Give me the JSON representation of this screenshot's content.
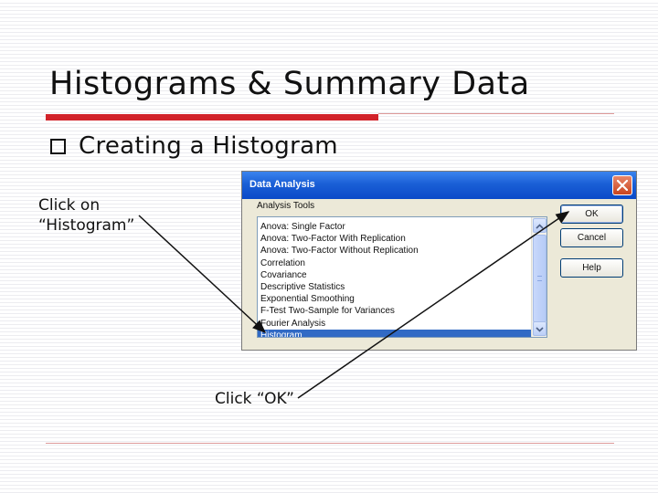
{
  "slide": {
    "title": "Histograms & Summary Data",
    "bullet": "Creating a Histogram",
    "callout_histogram_1": "Click on",
    "callout_histogram_2": "“Histogram”",
    "callout_ok": "Click “OK”"
  },
  "dialog": {
    "title": "Data Analysis",
    "tools_label": "Analysis Tools",
    "items": [
      "Anova: Single Factor",
      "Anova: Two-Factor With Replication",
      "Anova: Two-Factor Without Replication",
      "Correlation",
      "Covariance",
      "Descriptive Statistics",
      "Exponential Smoothing",
      "F-Test Two-Sample for Variances",
      "Fourier Analysis",
      "Histogram"
    ],
    "selected_index": 9,
    "ok_label": "OK",
    "cancel_label": "Cancel",
    "help_label": "Help",
    "close_icon": "close-icon"
  },
  "colors": {
    "accent_red": "#d2232a",
    "titlebar_blue": "#0b49c8",
    "selection_blue": "#316ac5"
  }
}
